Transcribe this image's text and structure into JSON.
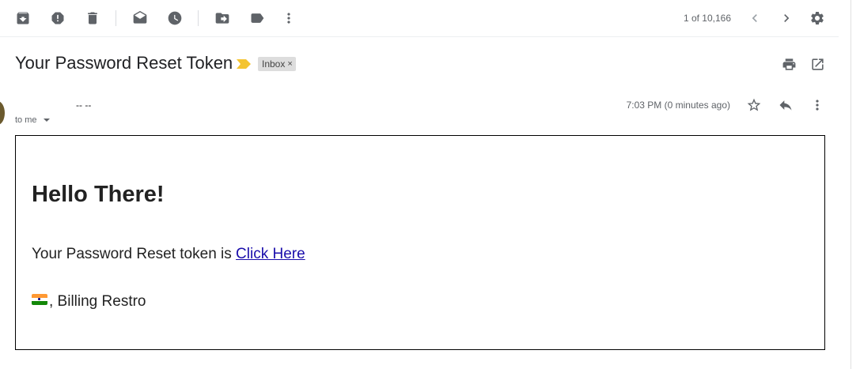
{
  "toolbar": {
    "icons": {
      "archive": "archive-icon",
      "spam": "report-spam-icon",
      "delete": "delete-icon",
      "mark_unread": "mark-unread-icon",
      "snooze": "snooze-icon",
      "move_to": "move-to-icon",
      "labels": "label-icon",
      "more": "more-vert-icon"
    },
    "pager_text": "1 of 10,166"
  },
  "message": {
    "subject": "Your Password Reset Token",
    "label_chip": "Inbox",
    "label_chip_close": "×",
    "to_me": "to me",
    "timestamp": "7:03 PM (0 minutes ago)",
    "sender_name": "-- --"
  },
  "email": {
    "greeting": "Hello There!",
    "token_prefix": "Your Password Reset token is ",
    "link_text": "Click Here",
    "signature_suffix": ", Billing Restro"
  },
  "colors": {
    "link": "#1a0dab",
    "importance": "#f4c430",
    "label_chip_bg": "#dddddd",
    "icon": "#5f6368"
  }
}
